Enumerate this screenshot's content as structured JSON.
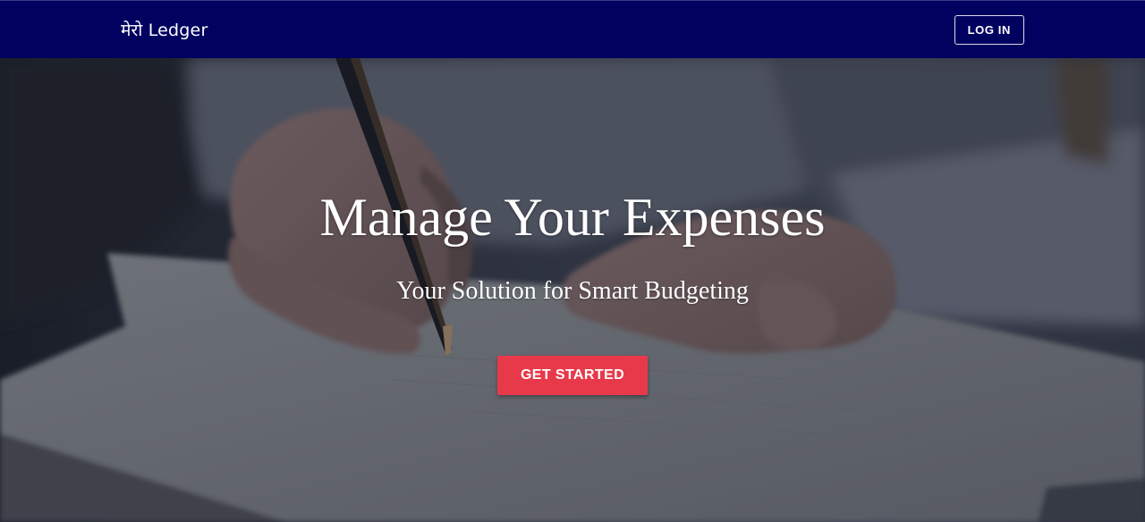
{
  "navbar": {
    "brand": "मेरो Ledger",
    "login_label": "LOG IN",
    "background": "#010160"
  },
  "hero": {
    "image": "hands-writing-on-paper-with-pen",
    "title": "Manage Your Expenses",
    "subtitle": "Your Solution for Smart Budgeting",
    "cta_label": "GET STARTED",
    "cta_color": "#e8394a"
  }
}
